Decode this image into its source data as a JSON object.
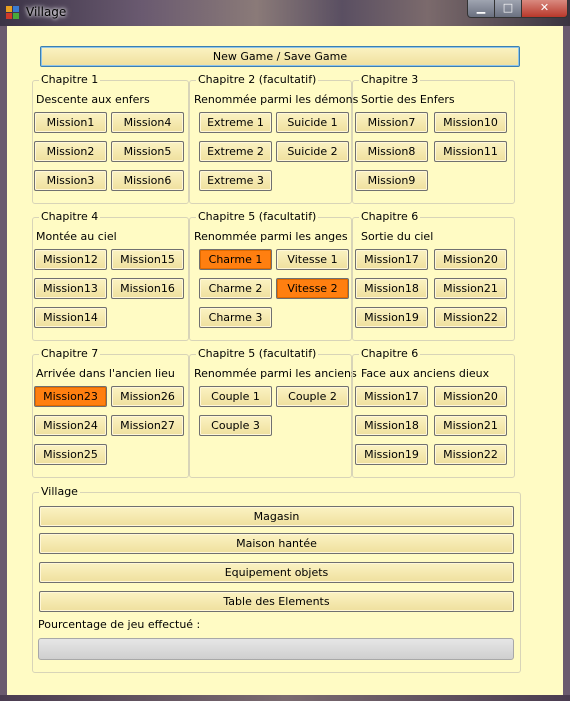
{
  "window": {
    "title": "Village",
    "controls": {
      "minimize": "▁",
      "maximize": "□",
      "close": "✕"
    }
  },
  "top_button": "New Game / Save Game",
  "groups": [
    {
      "title": "Chapitre 1",
      "subtitle": "Descente aux enfers",
      "buttons": [
        "Mission1",
        "Mission4",
        "Mission2",
        "Mission5",
        "Mission3",
        "Mission6"
      ]
    },
    {
      "title": "Chapitre 2 (facultatif)",
      "subtitle": "Renommée parmi les démons",
      "buttons": [
        "Extreme 1",
        "Suicide 1",
        "Extreme 2",
        "Suicide 2",
        "Extreme 3"
      ]
    },
    {
      "title": "Chapitre 3",
      "subtitle": "Sortie des Enfers",
      "buttons": [
        "Mission7",
        "Mission10",
        "Mission8",
        "Mission11",
        "Mission9"
      ]
    },
    {
      "title": "Chapitre 4",
      "subtitle": "Montée au ciel",
      "buttons": [
        "Mission12",
        "Mission15",
        "Mission13",
        "Mission16",
        "Mission14"
      ]
    },
    {
      "title": "Chapitre 5 (facultatif)",
      "subtitle": "Renommée parmi les anges",
      "buttons": [
        "Charme 1",
        "Vitesse 1",
        "Charme 2",
        "Vitesse 2",
        "Charme 3"
      ]
    },
    {
      "title": "Chapitre 6",
      "subtitle": "Sortie du ciel",
      "buttons": [
        "Mission17",
        "Mission20",
        "Mission18",
        "Mission21",
        "Mission19",
        "Mission22"
      ]
    },
    {
      "title": "Chapitre 7",
      "subtitle": "Arrivée dans l'ancien lieu",
      "buttons": [
        "Mission23",
        "Mission26",
        "Mission24",
        "Mission27",
        "Mission25"
      ]
    },
    {
      "title": "Chapitre 5 (facultatif)",
      "subtitle": "Renommée parmi les anciens",
      "buttons": [
        "Couple 1",
        "Couple 2",
        "Couple 3"
      ]
    },
    {
      "title": "Chapitre 6",
      "subtitle": "Face aux anciens dieux",
      "buttons": [
        "Mission17",
        "Mission20",
        "Mission18",
        "Mission21",
        "Mission19",
        "Mission22"
      ]
    }
  ],
  "highlighted": [
    "Charme 1",
    "Vitesse 2",
    "Mission23"
  ],
  "village": {
    "title": "Village",
    "buttons": [
      "Magasin",
      "Maison hantée",
      "Equipement objets",
      "Table des Elements"
    ],
    "progress_label": "Pourcentage de jeu effectué :",
    "progress_value": 0
  },
  "colors": {
    "background": "#fffbc4",
    "button": "#f3e6a8",
    "highlight": "#ff7f10"
  }
}
